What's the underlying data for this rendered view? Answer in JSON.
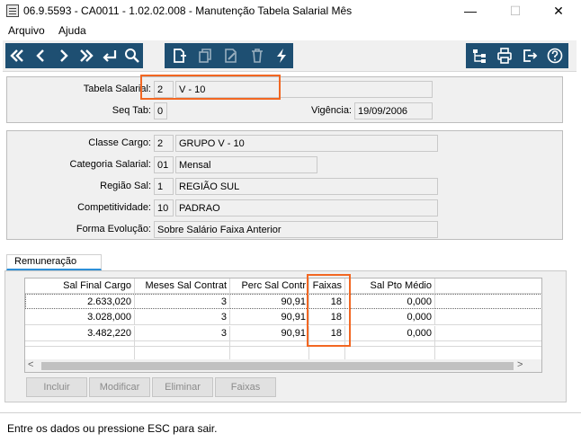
{
  "window": {
    "title": "06.9.5593 - CA0011 - 1.02.02.008 - Manutenção Tabela Salarial Mês",
    "minimize": "—",
    "maximize": "☐",
    "close": "✕"
  },
  "menu": {
    "items": [
      {
        "label": "Arquivo"
      },
      {
        "label": "Ajuda"
      }
    ]
  },
  "toolbar": {
    "icons": [
      "first-icon",
      "previous-icon",
      "next-icon",
      "last-icon",
      "enter-icon",
      "search-icon",
      "new-icon",
      "copy-icon",
      "edit-icon",
      "delete-icon",
      "execute-icon",
      "tree-icon",
      "print-icon",
      "exit-icon",
      "help-icon"
    ],
    "color": "#1e4f72"
  },
  "header": {
    "tabela_salarial": {
      "label": "Tabela Salarial:",
      "code": "2",
      "name": "V - 10"
    },
    "seq_tab": {
      "label": "Seq Tab:",
      "value": "0"
    },
    "vigencia": {
      "label": "Vigência:",
      "value": "19/09/2006"
    }
  },
  "details": {
    "classe_cargo": {
      "label": "Classe Cargo:",
      "code": "2",
      "name": "GRUPO V - 10"
    },
    "categoria_salarial": {
      "label": "Categoria Salarial:",
      "code": "01",
      "name": "Mensal"
    },
    "regiao_sal": {
      "label": "Região Sal:",
      "code": "1",
      "name": "REGIÃO SUL"
    },
    "competitividade": {
      "label": "Competitividade:",
      "code": "10",
      "name": "PADRAO"
    },
    "forma_evolucao": {
      "label": "Forma Evolução:",
      "value": "Sobre Salário Faixa Anterior"
    }
  },
  "tabs": [
    {
      "label": "Remuneração"
    }
  ],
  "grid": {
    "columns": [
      "Sal Final Cargo",
      "Meses Sal Contrat",
      "Perc Sal Contr",
      "Faixas",
      "Sal Pto Médio"
    ],
    "rows": [
      [
        "2.633,020",
        "3",
        "90,91",
        "18",
        "0,000"
      ],
      [
        "3.028,000",
        "3",
        "90,91",
        "18",
        "0,000"
      ],
      [
        "3.482,220",
        "3",
        "90,91",
        "18",
        "0,000"
      ]
    ],
    "scroll_up": "˄",
    "scroll_down": "˅",
    "scroll_left": "<",
    "scroll_right": ">"
  },
  "buttons": {
    "incluir": "Incluir",
    "modificar": "Modificar",
    "eliminar": "Eliminar",
    "faixas": "Faixas"
  },
  "status": {
    "text": "Entre os dados ou pressione ESC para sair."
  },
  "colors": {
    "highlight": "#f26722",
    "tab_accent": "#2d8fd8"
  }
}
